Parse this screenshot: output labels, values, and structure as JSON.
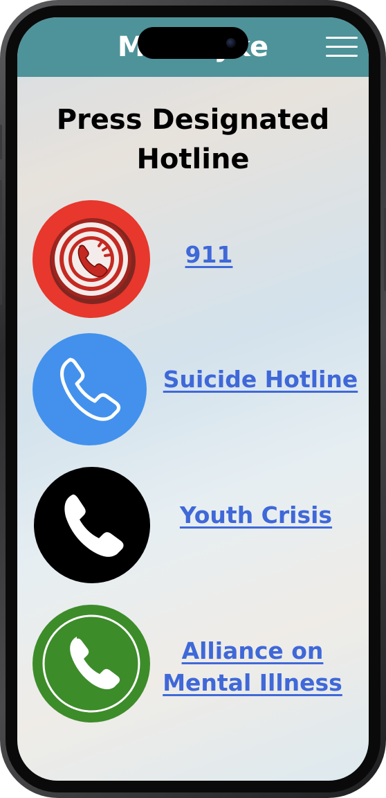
{
  "header": {
    "app_title": "MindSyke",
    "menu_icon": "hamburger-menu-icon"
  },
  "main": {
    "heading": "Press Designated Hotline",
    "hotlines": [
      {
        "label": "911",
        "icon": "emergency-phone-icon",
        "color": "#e8372c"
      },
      {
        "label": "Suicide Hotline",
        "icon": "phone-outline-icon",
        "color": "#4391ed"
      },
      {
        "label": "Youth Crisis",
        "icon": "phone-icon",
        "color": "#000000"
      },
      {
        "label": "Alliance on Mental Illness",
        "icon": "phone-ring-icon",
        "color": "#3d8c2a"
      }
    ]
  },
  "colors": {
    "header_bg": "#4e9399",
    "link": "#3f68d8"
  }
}
